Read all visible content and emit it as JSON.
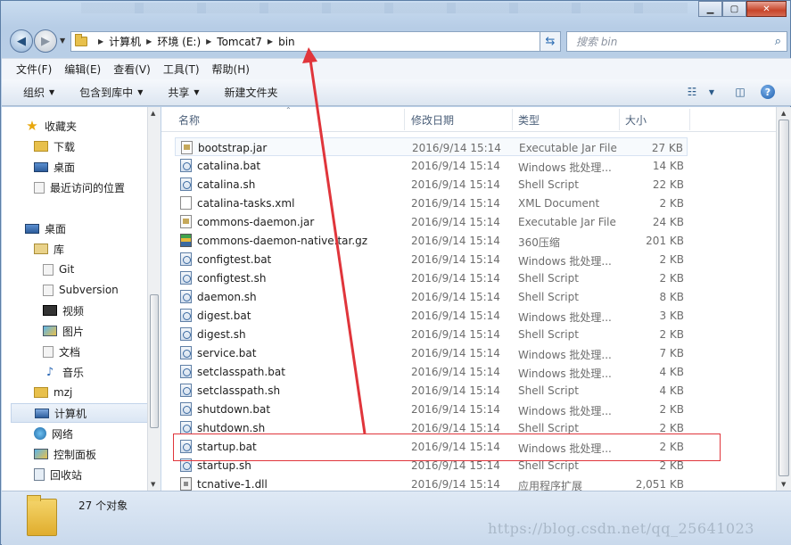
{
  "title_bar": {
    "buttons": [
      "minimize",
      "maximize",
      "close"
    ]
  },
  "address_bar": {
    "path": [
      "计算机",
      "环境 (E:)",
      "Tomcat7",
      "bin"
    ],
    "search_placeholder": "搜索 bin"
  },
  "menu": [
    "文件(F)",
    "编辑(E)",
    "查看(V)",
    "工具(T)",
    "帮助(H)"
  ],
  "toolbar": {
    "organize": "组织",
    "include_library": "包含到库中",
    "share": "共享",
    "new_folder": "新建文件夹"
  },
  "nav_pane": {
    "favorites": {
      "label": "收藏夹",
      "items": [
        "下载",
        "桌面",
        "最近访问的位置"
      ]
    },
    "desktop": "桌面",
    "libraries": {
      "label": "库",
      "items": [
        "Git",
        "Subversion",
        "视频",
        "图片",
        "文档",
        "音乐"
      ]
    },
    "mzj": "mzj",
    "computer": "计算机",
    "network": "网络",
    "control_panel": "控制面板",
    "recycle_bin": "回收站"
  },
  "columns": {
    "name": "名称",
    "date": "修改日期",
    "type": "类型",
    "size": "大小"
  },
  "files": [
    {
      "name": "bootstrap.jar",
      "date": "2016/9/14 15:14",
      "type": "Executable Jar File",
      "size": "27 KB",
      "icon": "jar-icon"
    },
    {
      "name": "catalina.bat",
      "date": "2016/9/14 15:14",
      "type": "Windows 批处理...",
      "size": "14 KB",
      "icon": "bat-icon"
    },
    {
      "name": "catalina.sh",
      "date": "2016/9/14 15:14",
      "type": "Shell Script",
      "size": "22 KB",
      "icon": "bat-icon"
    },
    {
      "name": "catalina-tasks.xml",
      "date": "2016/9/14 15:14",
      "type": "XML Document",
      "size": "2 KB",
      "icon": "xml-icon"
    },
    {
      "name": "commons-daemon.jar",
      "date": "2016/9/14 15:14",
      "type": "Executable Jar File",
      "size": "24 KB",
      "icon": "jar-icon"
    },
    {
      "name": "commons-daemon-native.tar.gz",
      "date": "2016/9/14 15:14",
      "type": "360压缩",
      "size": "201 KB",
      "icon": "archive-icon"
    },
    {
      "name": "configtest.bat",
      "date": "2016/9/14 15:14",
      "type": "Windows 批处理...",
      "size": "2 KB",
      "icon": "bat-icon"
    },
    {
      "name": "configtest.sh",
      "date": "2016/9/14 15:14",
      "type": "Shell Script",
      "size": "2 KB",
      "icon": "bat-icon"
    },
    {
      "name": "daemon.sh",
      "date": "2016/9/14 15:14",
      "type": "Shell Script",
      "size": "8 KB",
      "icon": "bat-icon"
    },
    {
      "name": "digest.bat",
      "date": "2016/9/14 15:14",
      "type": "Windows 批处理...",
      "size": "3 KB",
      "icon": "bat-icon"
    },
    {
      "name": "digest.sh",
      "date": "2016/9/14 15:14",
      "type": "Shell Script",
      "size": "2 KB",
      "icon": "bat-icon"
    },
    {
      "name": "service.bat",
      "date": "2016/9/14 15:14",
      "type": "Windows 批处理...",
      "size": "7 KB",
      "icon": "bat-icon"
    },
    {
      "name": "setclasspath.bat",
      "date": "2016/9/14 15:14",
      "type": "Windows 批处理...",
      "size": "4 KB",
      "icon": "bat-icon"
    },
    {
      "name": "setclasspath.sh",
      "date": "2016/9/14 15:14",
      "type": "Shell Script",
      "size": "4 KB",
      "icon": "bat-icon"
    },
    {
      "name": "shutdown.bat",
      "date": "2016/9/14 15:14",
      "type": "Windows 批处理...",
      "size": "2 KB",
      "icon": "bat-icon"
    },
    {
      "name": "shutdown.sh",
      "date": "2016/9/14 15:14",
      "type": "Shell Script",
      "size": "2 KB",
      "icon": "bat-icon"
    },
    {
      "name": "startup.bat",
      "date": "2016/9/14 15:14",
      "type": "Windows 批处理...",
      "size": "2 KB",
      "icon": "bat-icon"
    },
    {
      "name": "startup.sh",
      "date": "2016/9/14 15:14",
      "type": "Shell Script",
      "size": "2 KB",
      "icon": "bat-icon"
    },
    {
      "name": "tcnative-1.dll",
      "date": "2016/9/14 15:14",
      "type": "应用程序扩展",
      "size": "2,051 KB",
      "icon": "dll-icon"
    }
  ],
  "status": {
    "count": "27 个对象"
  },
  "watermark": "https://blog.csdn.net/qq_25641023",
  "annotation_color": "#e0353b"
}
